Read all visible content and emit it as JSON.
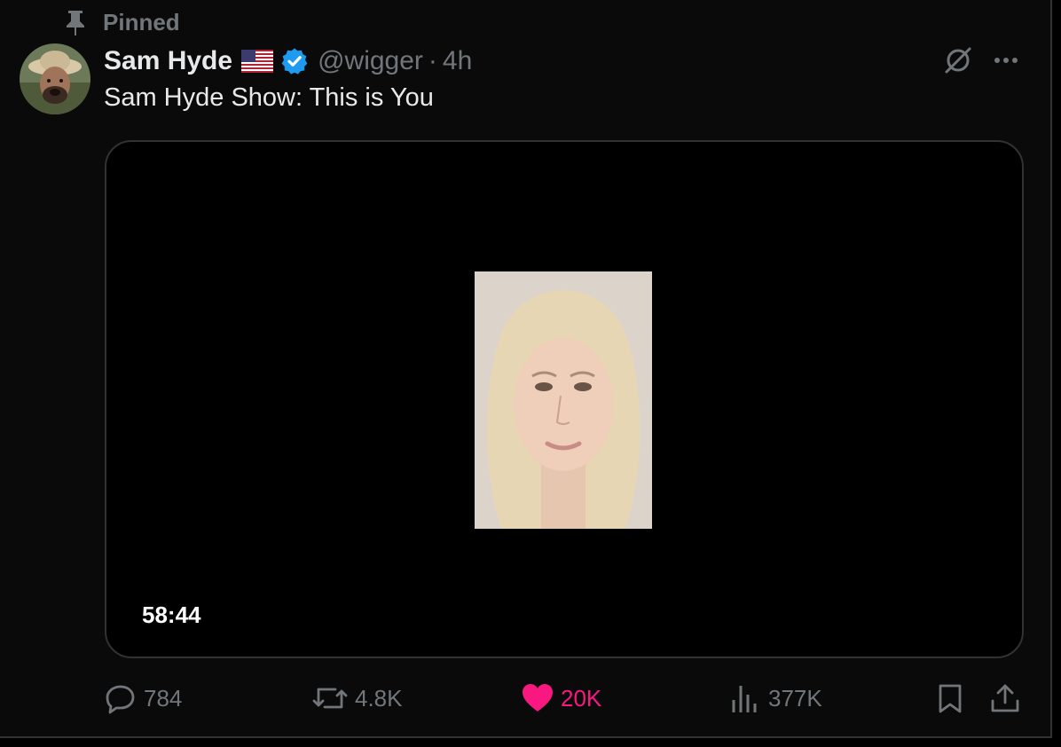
{
  "pinned": {
    "label": "Pinned"
  },
  "author": {
    "name": "Sam Hyde",
    "handle": "@wigger",
    "time": "4h",
    "separator": "·"
  },
  "tweet": {
    "text": "Sam Hyde Show: This is You"
  },
  "media": {
    "duration": "58:44"
  },
  "actions": {
    "replies": "784",
    "reposts": "4.8K",
    "likes": "20K",
    "views": "377K"
  },
  "colors": {
    "background": "#000000",
    "text": "#e7e9ea",
    "muted": "#71767b",
    "like": "#f91880",
    "verified": "#1d9bf0",
    "border": "#2f3336"
  },
  "icons": {
    "pinned": "pin-icon",
    "flag": "us-flag-icon",
    "verified": "verified-badge-icon",
    "grok": "grok-icon",
    "more": "more-icon",
    "reply": "reply-icon",
    "repost": "repost-icon",
    "like": "heart-icon",
    "views": "views-icon",
    "bookmark": "bookmark-icon",
    "share": "share-icon"
  }
}
